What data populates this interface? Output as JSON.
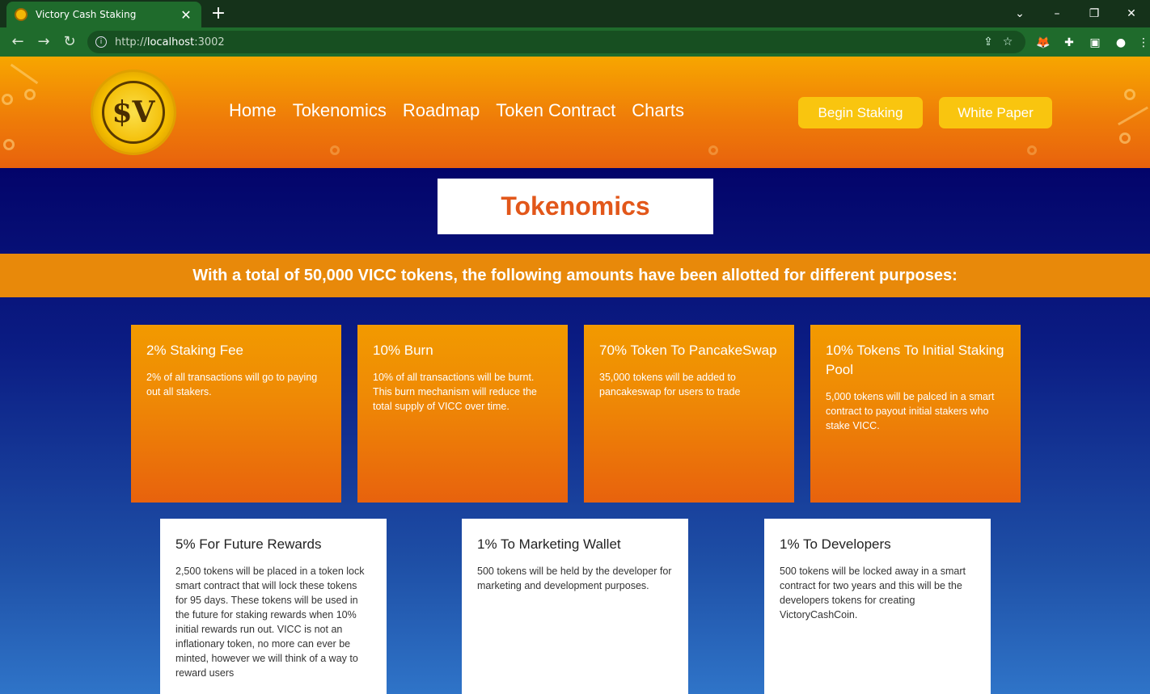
{
  "browser": {
    "tab_title": "Victory Cash Staking",
    "tab_close": "✕",
    "new_tab": "+",
    "url_prefix": "http://",
    "url_host": "localhost",
    "url_port": ":3002",
    "icons": [
      "back-arrow-icon",
      "forward-arrow-icon",
      "reload-icon",
      "info-icon",
      "share-icon",
      "star-icon",
      "metamask-icon",
      "extensions-puzzle-icon",
      "sidepanel-icon",
      "profile-icon",
      "menu-kebab-icon"
    ]
  },
  "header": {
    "logo_symbol": "$V",
    "nav": [
      "Home",
      "Tokenomics",
      "Roadmap",
      "Token Contract",
      "Charts"
    ],
    "begin_staking": "Begin Staking",
    "white_paper": "White Paper"
  },
  "main": {
    "title": "Tokenomics",
    "banner": "With a total of 50,000 VICC tokens, the following amounts have been allotted for different purposes:",
    "cards_top": [
      {
        "title": "2% Staking Fee",
        "text": "2% of all transactions will go to paying out all stakers."
      },
      {
        "title": "10% Burn",
        "text": "10% of all transactions will be burnt. This burn mechanism will reduce the total supply of VICC over time."
      },
      {
        "title": "70% Token To PancakeSwap",
        "text": "35,000 tokens will be added to pancakeswap for users to trade"
      },
      {
        "title": "10% Tokens To Initial Staking Pool",
        "text": "5,000 tokens will be palced in a smart contract to payout initial stakers who stake VICC."
      }
    ],
    "cards_bottom": [
      {
        "title": "5% For Future Rewards",
        "text": "2,500 tokens will be placed in a token lock smart contract that will lock these tokens for 95 days. These tokens will be used in the future for staking rewards when 10% initial rewards run out. VICC is not an inflationary token, no more can ever be minted, however we will think of a way to reward users"
      },
      {
        "title": "1% To Marketing Wallet",
        "text": "500 tokens will be held by the developer for marketing and development purposes."
      },
      {
        "title": "1% To Developers",
        "text": "500 tokens will be locked away in a smart contract for two years and this will be the developers tokens for creating VictoryCashCoin."
      }
    ]
  },
  "colors": {
    "header_orange": "#ef7d08",
    "button_yellow": "#f9c50f",
    "title_orange": "#e2571a",
    "page_navy": "#03046a"
  }
}
